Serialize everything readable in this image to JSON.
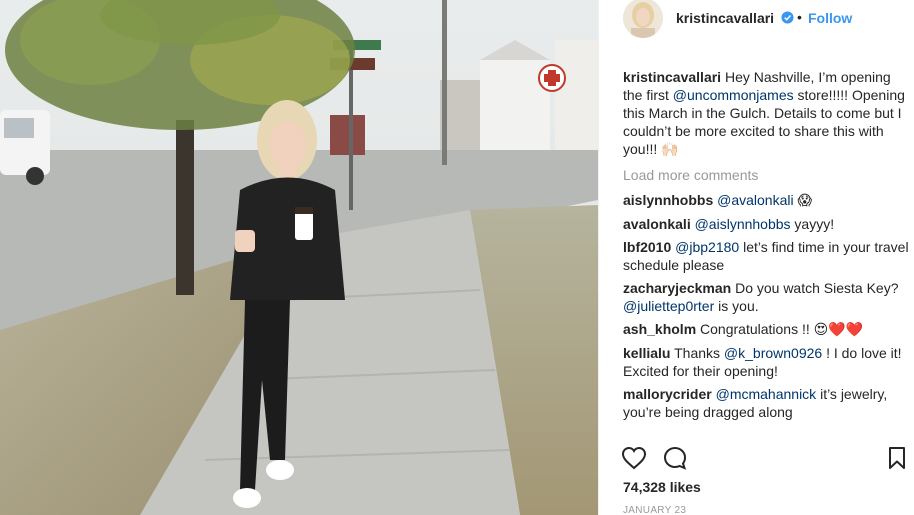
{
  "post": {
    "username": "kristincavallari",
    "follow_label": "Follow",
    "separator": "•",
    "caption": {
      "username": "kristincavallari",
      "text_1": " Hey Nashville, I’m opening the first ",
      "mention": "@uncommonjames",
      "text_2": " store!!!!! Opening this March in the Gulch. Details to come but I couldn’t be more excited to share this with you!!! ",
      "emoji": "🙌🏻"
    },
    "load_more_label": "Load more comments",
    "comments": [
      {
        "username": "aislynnhobbs",
        "mention": "@avalonkali",
        "text": " ",
        "emoji": "😱"
      },
      {
        "username": "avalonkali",
        "mention": "@aislynnhobbs",
        "text": " yayyy!",
        "emoji": ""
      },
      {
        "username": "lbf2010",
        "mention": "@jbp2180",
        "text": " let’s find time in your travel schedule please",
        "emoji": ""
      },
      {
        "username": "zacharyjeckman",
        "mention": "",
        "text": " Do you watch Siesta Key? ",
        "mention2": "@juliettep0rter",
        "text2": " is you.",
        "emoji": ""
      },
      {
        "username": "ash_kholm",
        "mention": "",
        "text": " Congratulations !! ",
        "emoji": "😍❤️❤️"
      },
      {
        "username": "kellialu",
        "mention": "",
        "text": " Thanks ",
        "mention2": "@k_brown0926",
        "text2": " ! I do love it! Excited for their opening!",
        "emoji": ""
      },
      {
        "username": "mallorycrider",
        "mention": "@mcmahannick",
        "text": " it’s jewelry, you’re being dragged along",
        "emoji": ""
      }
    ],
    "likes": "74,328 likes",
    "date": "JANUARY 23"
  },
  "icons": {
    "like": "heart-icon",
    "comment": "comment-icon",
    "save": "bookmark-icon",
    "verified": "verified-badge-icon"
  },
  "colors": {
    "link": "#003569",
    "follow": "#3897f0",
    "muted": "#999999",
    "text": "#262626"
  }
}
